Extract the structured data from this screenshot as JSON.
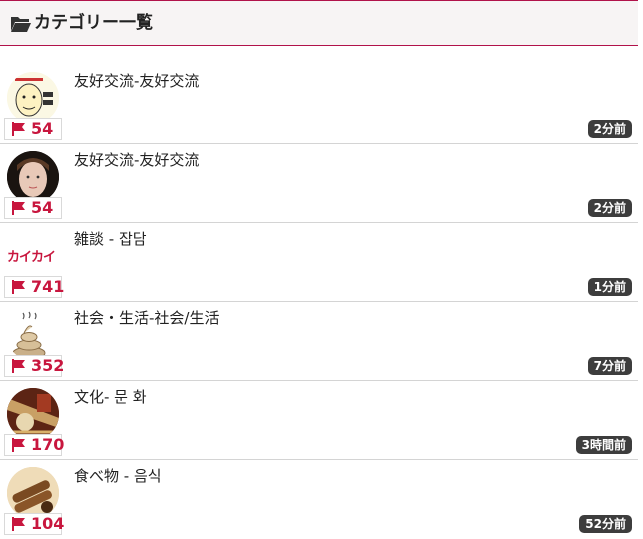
{
  "header": {
    "title": "カテゴリー一覧"
  },
  "categories": [
    {
      "title": "友好交流-友好交流",
      "count": "54",
      "time": "2分前",
      "thumb": "face-icon"
    },
    {
      "title": "友好交流-友好交流",
      "count": "54",
      "time": "2分前",
      "thumb": "portrait"
    },
    {
      "title": "雑談 - 잡담",
      "count": "741",
      "time": "1分前",
      "thumb": "kaikai-logo",
      "logo_text": "カイカイ"
    },
    {
      "title": "社会・生活-社会/生活",
      "count": "352",
      "time": "7分前",
      "thumb": "poop-icon"
    },
    {
      "title": "文化- 문 화",
      "count": "170",
      "time": "3時間前",
      "thumb": "culture-photo"
    },
    {
      "title": "食べ物 - 음식",
      "count": "104",
      "time": "52分前",
      "thumb": "food-photo"
    }
  ],
  "colors": {
    "accent": "#b1124a",
    "count": "#c8163e",
    "badge": "#3d3d3d"
  }
}
